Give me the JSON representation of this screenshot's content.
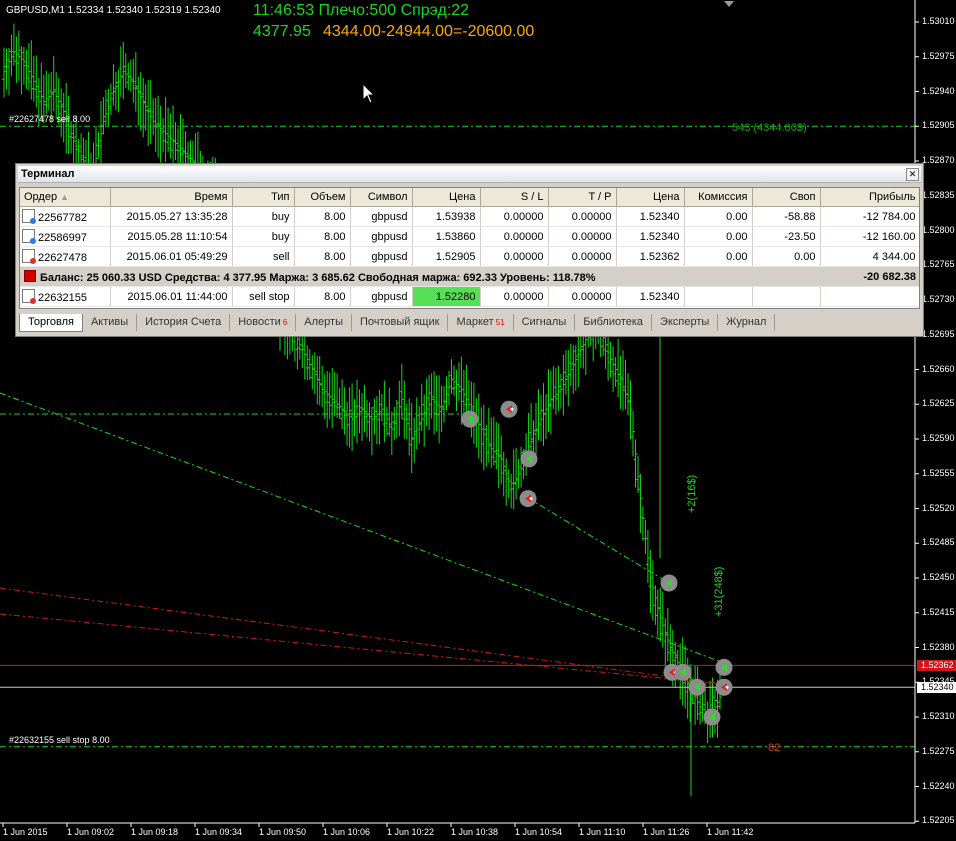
{
  "header": {
    "symbol_info": "GBPUSD,M1  1.52334 1.52340 1.52319 1.52340",
    "line1": "11:46:53 Плечо:500 Спрэд:22",
    "equity": "4377.95",
    "formula": "4344.00-24944.00=-20600.00"
  },
  "chart_data": {
    "type": "candlestick",
    "symbol": "GBPUSD",
    "timeframe": "M1",
    "ylim": [
      1.52205,
      1.5301
    ],
    "price_ticks": [
      "1.53010",
      "1.52975",
      "1.52940",
      "1.52905",
      "1.52870",
      "1.52835",
      "1.52800",
      "1.52765",
      "1.52730",
      "1.52695",
      "1.52660",
      "1.52625",
      "1.52590",
      "1.52555",
      "1.52520",
      "1.52485",
      "1.52450",
      "1.52415",
      "1.52380",
      "1.52345",
      "1.52310",
      "1.52275",
      "1.52240",
      "1.52205"
    ],
    "time_ticks": [
      "1 Jun 2015",
      "1 Jun 09:02",
      "1 Jun 09:18",
      "1 Jun 09:34",
      "1 Jun 09:50",
      "1 Jun 10:06",
      "1 Jun 10:22",
      "1 Jun 10:38",
      "1 Jun 10:54",
      "1 Jun 11:10",
      "1 Jun 11:26",
      "1 Jun 11:42"
    ],
    "current_bid": "1.52340",
    "current_ask": "1.52362",
    "close_path": [
      1.5296,
      1.5298,
      1.5297,
      1.5295,
      1.5293,
      1.5294,
      1.5292,
      1.5289,
      1.5287,
      1.5286,
      1.5291,
      1.5294,
      1.5296,
      1.5295,
      1.5293,
      1.5291,
      1.529,
      1.5289,
      1.5288,
      1.5287,
      1.5286,
      1.5284,
      1.5283,
      1.5281,
      1.5279,
      1.5277,
      1.5275,
      1.5273,
      1.5271,
      1.527,
      1.5268,
      1.5266,
      1.5264,
      1.5263,
      1.5262,
      1.5261,
      1.5262,
      1.5261,
      1.5262,
      1.526,
      1.5263,
      1.5259,
      1.5261,
      1.5263,
      1.5262,
      1.5265,
      1.5264,
      1.5262,
      1.526,
      1.5258,
      1.5257,
      1.5254,
      1.5256,
      1.5259,
      1.5261,
      1.5263,
      1.5264,
      1.5266,
      1.5268,
      1.527,
      1.527,
      1.5267,
      1.5265,
      1.5262,
      1.5253,
      1.5245,
      1.5241,
      1.5238,
      1.5236,
      1.5234,
      1.5232,
      1.5231,
      1.5233
    ],
    "order_lines": [
      {
        "label": "#22627478 sell 8.00",
        "price": 1.52905
      },
      {
        "label": "#22632155 sell stop 8.00",
        "price": 1.5228
      }
    ],
    "annotations": [
      {
        "text": "543 (4344.00$)",
        "price": 1.52905
      },
      {
        "text": "82",
        "price": 1.5228
      },
      {
        "text": "+2(16$)"
      },
      {
        "text": "+31(248$)"
      }
    ],
    "markers": [
      {
        "kind": "buy",
        "price": 1.5261
      },
      {
        "kind": "sell",
        "price": 1.5262
      },
      {
        "kind": "buy",
        "price": 1.5257
      },
      {
        "kind": "sell",
        "price": 1.5253
      },
      {
        "kind": "buy",
        "price": 1.52445
      },
      {
        "kind": "sell",
        "price": 1.52355
      },
      {
        "kind": "buy",
        "price": 1.52355
      },
      {
        "kind": "buy",
        "price": 1.5234
      },
      {
        "kind": "buy",
        "price": 1.5231
      },
      {
        "kind": "buy",
        "price": 1.5236
      },
      {
        "kind": "sell",
        "price": 1.5234
      }
    ],
    "colors": {
      "bull": "#16d916",
      "bear": "#16d916",
      "ask_line": "#d01818",
      "bid_line": "#ffffff",
      "order_line": "#16d916"
    }
  },
  "terminal": {
    "title": "Терминал",
    "columns": [
      "Ордер",
      "Время",
      "Тип",
      "Объем",
      "Символ",
      "Цена",
      "S / L",
      "T / P",
      "Цена",
      "Комиссия",
      "Своп",
      "Прибыль"
    ],
    "rows": [
      {
        "order": "22567782",
        "time": "2015.05.27 13:35:28",
        "type": "buy",
        "volume": "8.00",
        "symbol": "gbpusd",
        "price": "1.53938",
        "sl": "0.00000",
        "tp": "0.00000",
        "cur_price": "1.52340",
        "commission": "0.00",
        "swap": "-58.88",
        "profit": "-12 784.00"
      },
      {
        "order": "22586997",
        "time": "2015.05.28 11:10:54",
        "type": "buy",
        "volume": "8.00",
        "symbol": "gbpusd",
        "price": "1.53860",
        "sl": "0.00000",
        "tp": "0.00000",
        "cur_price": "1.52340",
        "commission": "0.00",
        "swap": "-23.50",
        "profit": "-12 160.00"
      },
      {
        "order": "22627478",
        "time": "2015.06.01 05:49:29",
        "type": "sell",
        "volume": "8.00",
        "symbol": "gbpusd",
        "price": "1.52905",
        "sl": "0.00000",
        "tp": "0.00000",
        "cur_price": "1.52362",
        "commission": "0.00",
        "swap": "0.00",
        "profit": "4 344.00"
      }
    ],
    "summary": "Баланс: 25 060.33 USD  Средства: 4 377.95  Маржа: 3 685.62  Свободная маржа: 692.33  Уровень: 118.78%",
    "summary_profit": "-20 682.38",
    "pending": {
      "order": "22632155",
      "time": "2015.06.01 11:44:00",
      "type": "sell stop",
      "volume": "8.00",
      "symbol": "gbpusd",
      "price": "1.52280",
      "sl": "0.00000",
      "tp": "0.00000",
      "cur_price": "1.52340"
    },
    "tabs": [
      {
        "label": "Торговля",
        "badge": ""
      },
      {
        "label": "Активы",
        "badge": ""
      },
      {
        "label": "История Счета",
        "badge": ""
      },
      {
        "label": "Новости",
        "badge": "6"
      },
      {
        "label": "Алерты",
        "badge": ""
      },
      {
        "label": "Почтовый ящик",
        "badge": ""
      },
      {
        "label": "Маркет",
        "badge": "51"
      },
      {
        "label": "Сигналы",
        "badge": ""
      },
      {
        "label": "Библиотека",
        "badge": ""
      },
      {
        "label": "Эксперты",
        "badge": ""
      },
      {
        "label": "Журнал",
        "badge": ""
      }
    ]
  }
}
